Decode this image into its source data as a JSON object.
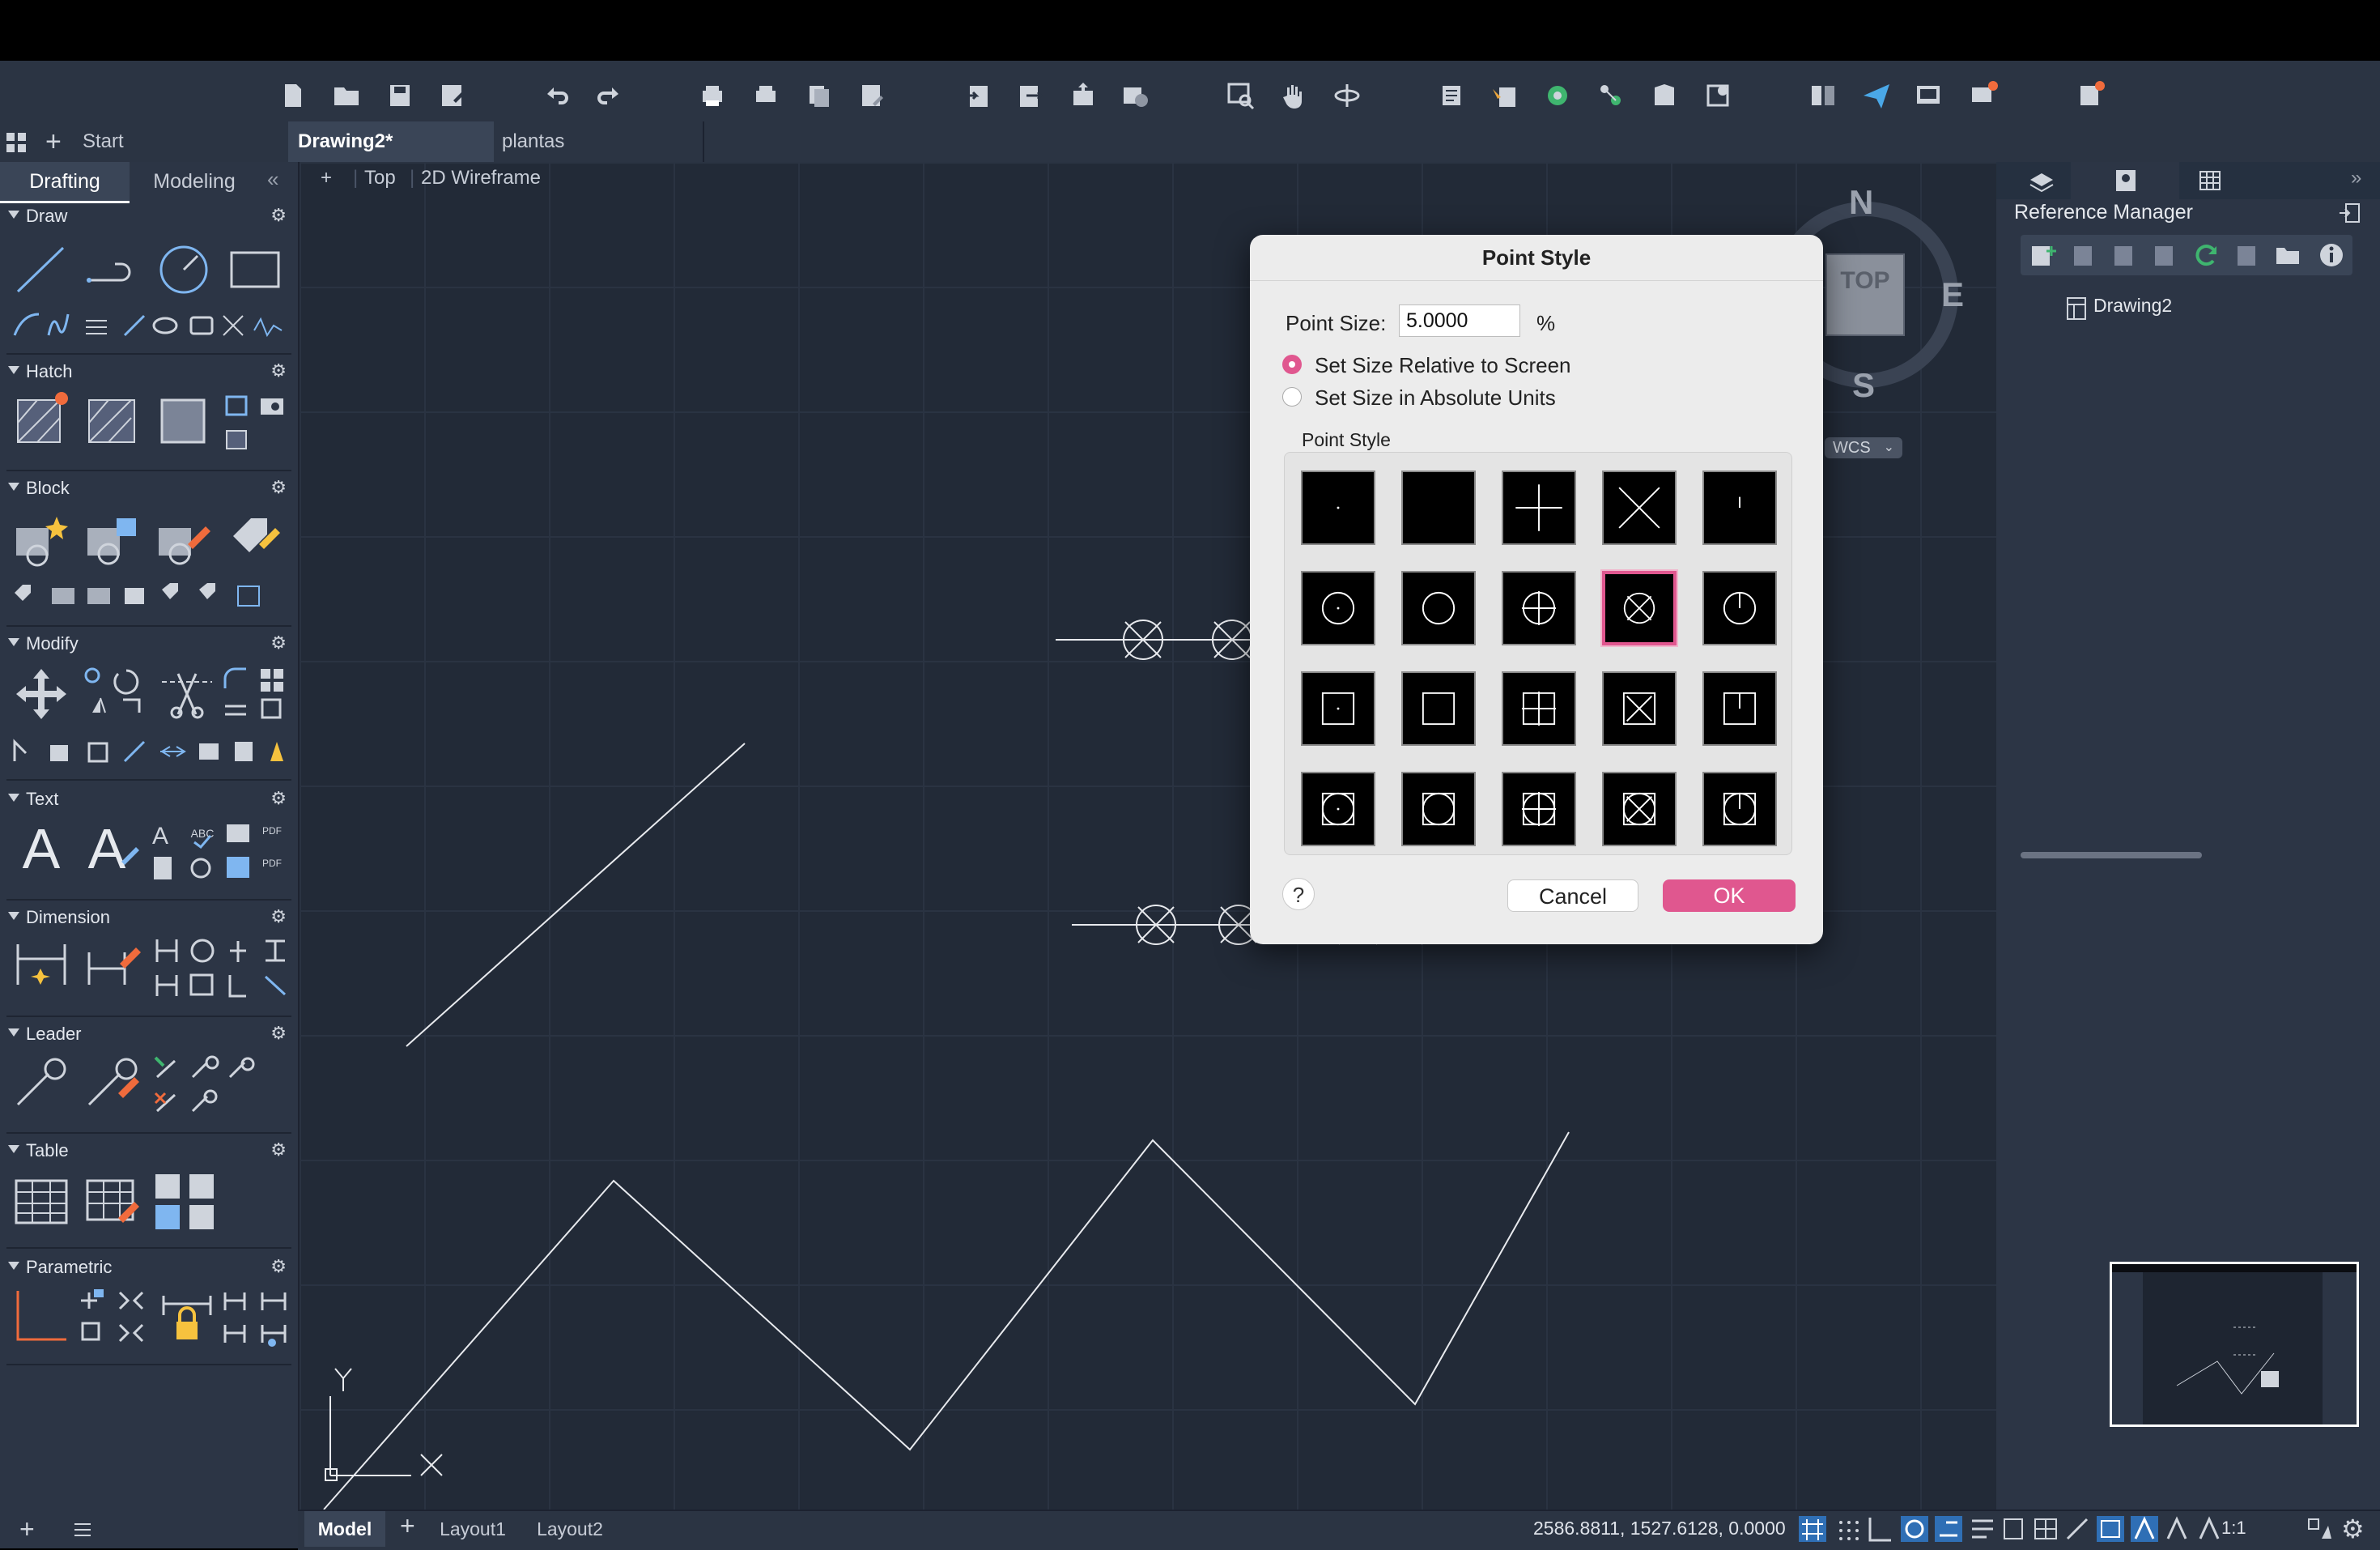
{
  "tabs": {
    "start": "Start",
    "drawing": "Drawing2*",
    "plantas": "plantas"
  },
  "palette": {
    "tab_drafting": "Drafting",
    "tab_modeling": "Modeling",
    "sections": {
      "draw": "Draw",
      "hatch": "Hatch",
      "block": "Block",
      "modify": "Modify",
      "text": "Text",
      "dimension": "Dimension",
      "leader": "Leader",
      "table": "Table",
      "parametric": "Parametric"
    }
  },
  "viewport": {
    "plus": "+",
    "view": "Top",
    "visual_style": "2D Wireframe"
  },
  "viewcube": {
    "north": "N",
    "east": "E",
    "south": "S",
    "face": "TOP",
    "wcs": "WCS"
  },
  "ucs": {
    "x": "X",
    "y": "Y"
  },
  "right_panel": {
    "title": "Reference Manager",
    "item": "Drawing2"
  },
  "dialog": {
    "title": "Point Style",
    "point_size_label": "Point Size:",
    "point_size_value": "5.0000",
    "percent": "%",
    "option_relative": "Set Size Relative to Screen",
    "option_absolute": "Set Size in Absolute Units",
    "selected_option": "relative",
    "group_label": "Point Style",
    "selected_style": "circle-x",
    "help": "?",
    "cancel": "Cancel",
    "ok": "OK"
  },
  "status": {
    "layout_model": "Model",
    "layout_1": "Layout1",
    "layout_2": "Layout2",
    "coordinates": "2586.8811, 1527.6128, 0.0000",
    "scale": "1:1"
  },
  "colors": {
    "accent": "#e0578f",
    "canvas": "#222a37",
    "panel": "#2c3545"
  }
}
